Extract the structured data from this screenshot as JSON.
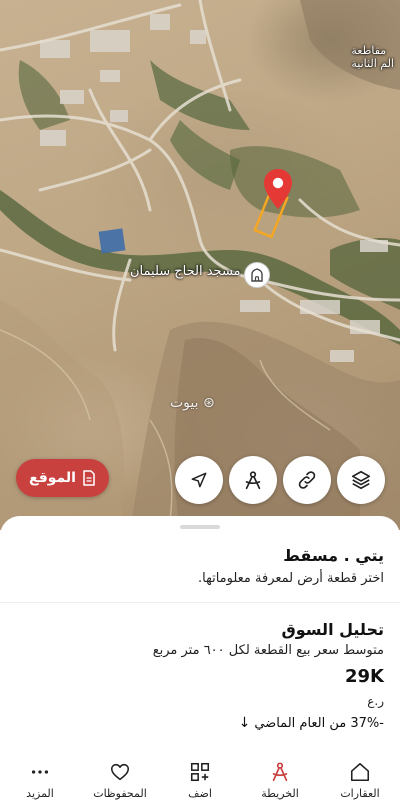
{
  "map": {
    "mosque_label": "مسجد الحاج سليمان",
    "region_label_line1": "مقاطعة",
    "region_label_line2": "الم الثانية",
    "watermark": "بيوت",
    "pin_color": "#e53935",
    "plot_outline_color": "#f5a623"
  },
  "controls": {
    "location_button_label": "الموقع",
    "layers_icon": "layers-icon",
    "link_icon": "link-icon",
    "measure_icon": "measure-icon",
    "locate_icon": "navigation-arrow-icon",
    "accent_color": "#c8413f"
  },
  "sheet": {
    "title": "يتي . مسقط",
    "subtitle": "اختر قطعة أرض لمعرفة معلوماتها.",
    "market_title": "تحليل السوق",
    "market_description": "متوسط سعر بيع القطعة لكل ٦٠٠ متر مربع",
    "price_value": "29K",
    "price_currency": "ر.ع",
    "change_text": "-37% من العام الماضي",
    "change_arrow": "↓"
  },
  "nav": {
    "items": [
      {
        "label": "العقارات",
        "icon": "home-icon"
      },
      {
        "label": "الخريطة",
        "icon": "map-icon",
        "active": true
      },
      {
        "label": "اضف",
        "icon": "add-grid-icon"
      },
      {
        "label": "المحفوظات",
        "icon": "heart-icon"
      },
      {
        "label": "المزيد",
        "icon": "more-dots-icon"
      }
    ]
  }
}
